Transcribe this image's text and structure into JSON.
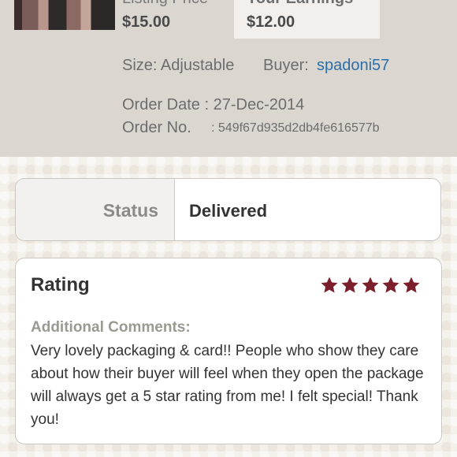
{
  "product": {
    "listing_price_label": "Listing Price",
    "listing_price": "$15.00",
    "earnings_label": "Your Earnings",
    "earnings": "$12.00",
    "size_text": "Size: Adjustable",
    "buyer_label": "Buyer:",
    "buyer_name": "spadoni57",
    "order_date_text": "Order Date : 27-Dec-2014",
    "order_no_label": "Order No.",
    "order_no_value": ": 549f67d935d2db4fe616577b"
  },
  "status": {
    "label": "Status",
    "value": "Delivered"
  },
  "rating": {
    "title": "Rating",
    "stars": 5,
    "star_color": "#7a1f2b",
    "comments_label": "Additional Comments:",
    "comments": "Very lovely packaging & card!! People who show they care about how their buyer will feel when they open the package will always get a 5 star rating from me! I felt special! Thank you!"
  },
  "colors": {
    "link": "#2b6fa8"
  }
}
